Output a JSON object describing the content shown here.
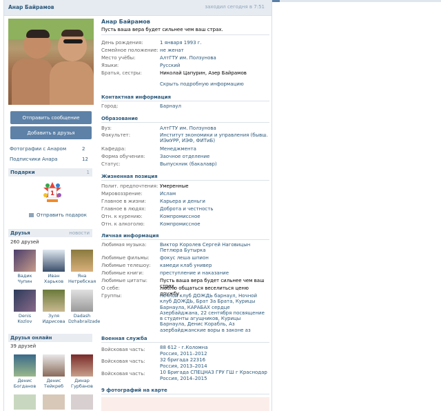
{
  "topbar": {
    "name": "Анар Байрамов",
    "status": "заходил сегодня в 7:51"
  },
  "left": {
    "send_message": "Отправить сообщение",
    "add_friend": "Добавить в друзья",
    "photos_link": "Фотографии с Анаром",
    "photos_count": "2",
    "subs_link": "Подписчики Анара",
    "subs_count": "12",
    "gifts_title": "Подарки",
    "gifts_count": "1",
    "send_gift": "Отправить подарок",
    "friends_title": "Друзья",
    "friends_news": "новости",
    "friends_count": "260 друзей",
    "friends": [
      {
        "name": "Вадик Чупин"
      },
      {
        "name": "Иван Харьков"
      },
      {
        "name": "Яна Нетребская"
      },
      {
        "name": "Denis Kozlov"
      },
      {
        "name": "Зуля Идрисова"
      },
      {
        "name": "Dadash Dzhabrailzade"
      }
    ],
    "online_title": "Друзья онлайн",
    "online_count": "39 друзей",
    "online": [
      {
        "name": "Денис Богданов"
      },
      {
        "name": "Денис Тейкреб"
      },
      {
        "name": "Динар Гурбанов"
      }
    ]
  },
  "profile": {
    "name": "Анар Байрамов",
    "status": "Пусть ваша вера будет сильнее чем ваш страх.",
    "rows": [
      {
        "label": "День рождения:",
        "value": "1 января 1993 г."
      },
      {
        "label": "Семейное положение:",
        "value": "не женат"
      },
      {
        "label": "Место учёбы:",
        "value": "АлтГТУ им. Ползунова"
      },
      {
        "label": "Языки:",
        "value": "Русский"
      },
      {
        "label": "Братья, сестры:",
        "value": "Николай Цапурин, Азер Байрамов"
      }
    ],
    "hide_info": "Скрыть подробную информацию"
  },
  "contacts": {
    "title": "Контактная информация",
    "rows": [
      {
        "label": "Город:",
        "value": "Барнаул"
      }
    ]
  },
  "education": {
    "title": "Образование",
    "rows": [
      {
        "label": "Вуз:",
        "value": "АлтГТУ им. Ползунова"
      },
      {
        "label": "Факультет:",
        "value": "Институт экономики и управления (бывш. ИЭиУРР, ИЭФ, ФИТиБ)"
      },
      {
        "label": "Кафедра:",
        "value": "Менеджмента"
      },
      {
        "label": "Форма обучения:",
        "value": "Заочное отделение"
      },
      {
        "label": "Статус:",
        "value": "Выпускник (бакалавр)"
      }
    ]
  },
  "life": {
    "title": "Жизненная позиция",
    "rows": [
      {
        "label": "Полит. предпочтения:",
        "value": "Умеренные"
      },
      {
        "label": "Мировоззрение:",
        "value": "Ислам"
      },
      {
        "label": "Главное в жизни:",
        "value": "Карьера и деньги"
      },
      {
        "label": "Главное в людях:",
        "value": "Доброта и честность"
      },
      {
        "label": "Отн. к курению:",
        "value": "Компромиссное"
      },
      {
        "label": "Отн. к алкоголю:",
        "value": "Компромиссное"
      }
    ]
  },
  "personal": {
    "title": "Личная информация",
    "rows": [
      {
        "label": "Любимая музыка:",
        "value": "Виктор Королев Сергей Наговицын Петлюра Бутырка"
      },
      {
        "label": "Любимые фильмы:",
        "value": "фокус леша шпион"
      },
      {
        "label": "Любимые телешоу:",
        "value": "камеди клаб универ"
      },
      {
        "label": "Любимые книги:",
        "value": "преступление и наказание"
      },
      {
        "label": "Любимые цитаты:",
        "value": "Пусть ваша вера будет сильнее чем ваш страх."
      },
      {
        "label": "О себе:",
        "value": "люблю общаться веселиться ценю дружбу"
      },
      {
        "label": "Группы:",
        "value": "ночной клуб ДОЖДЬ барнаул, Ночной клуб ДОЖДЬ, Брат За Брата, Курицы Барнаула, КАРАБАХ сердце Азербайджана, 22 сентября посвящение в студенты агущников, Курицы Барнаула, Денис Корабль, Аз азербайджанские воры в законе аз"
      }
    ]
  },
  "military": {
    "title": "Военная служба",
    "rows": [
      {
        "label": "Войсковая часть:",
        "value": "88 612 - г.Коломна",
        "sub": "Россия, 2011–2012"
      },
      {
        "label": "Войсковая часть:",
        "value": "32 бригада 22316",
        "sub": "Россия, 2013–2014"
      },
      {
        "label": "Войсковая часть:",
        "value": "10 Бригада СПЕЦНАЗ ГРУ ГШ г Краснодар",
        "sub": "Россия, 2014–2015"
      }
    ]
  },
  "map": {
    "title": "9 фотографий на карте"
  },
  "colors": {
    "link": "#2b587a",
    "button": "#5d81a7",
    "header_bg": "#e5ebf1"
  }
}
